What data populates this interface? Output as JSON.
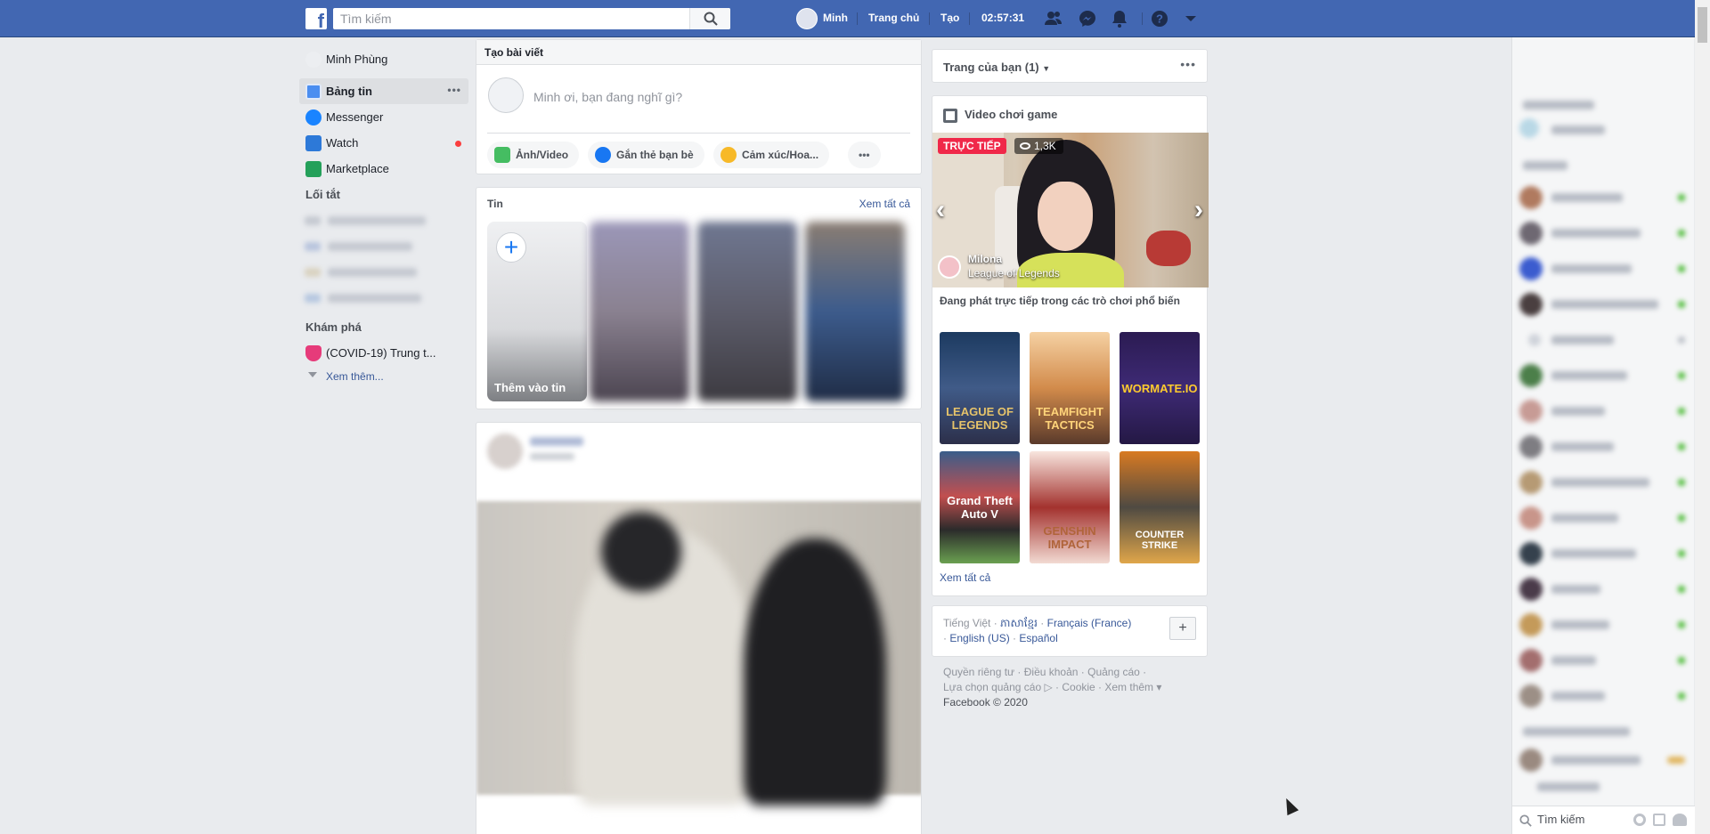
{
  "header": {
    "logo_letter": "f",
    "search_placeholder": "Tìm kiếm",
    "user_name": "Minh",
    "home": "Trang chủ",
    "create": "Tạo",
    "clock": "02:57:31"
  },
  "left_nav": {
    "profile": "Minh Phùng",
    "items": [
      {
        "label": "Bảng tin",
        "active": true
      },
      {
        "label": "Messenger"
      },
      {
        "label": "Watch"
      },
      {
        "label": "Marketplace"
      }
    ],
    "shortcuts_heading": "Lối tắt",
    "explore_heading": "Khám phá",
    "explore_item": "(COVID-19) Trung t...",
    "see_more": "Xem thêm..."
  },
  "composer": {
    "header": "Tạo bài viết",
    "prompt": "Minh ơi, bạn đang nghĩ gì?",
    "actions": [
      "Ảnh/Video",
      "Gắn thẻ bạn bè",
      "Cảm xúc/Hoa..."
    ],
    "more": "•••"
  },
  "stories": {
    "title": "Tin",
    "see_all": "Xem tất cả",
    "add_label": "Thêm vào tin",
    "plus": "+"
  },
  "right": {
    "pages_title": "Trang của bạn (1)",
    "pages_more": "•••",
    "games_title": "Video chơi game",
    "live_badge": "TRỰC TIẾP",
    "viewers": "1,3K",
    "streamer": "Milona",
    "stream_game": "League of Legends",
    "games_desc": "Đang phát trực tiếp trong các trò chơi phổ biến",
    "tiles": [
      "LEAGUE OF LEGENDS",
      "TEAMFIGHT TACTICS",
      "WORMATE.IO",
      "Grand Theft Auto V",
      "GENSHIN IMPACT",
      "COUNTER STRIKE"
    ],
    "games_see_all": "Xem tất cả"
  },
  "languages": {
    "current": "Tiếng Việt",
    "others": [
      "ភាសាខ្មែរ",
      "Français (France)",
      "English (US)",
      "Español"
    ],
    "add": "+"
  },
  "footer": {
    "line1": "Quyền riêng tư · Điều khoản · Quảng cáo ·",
    "line2": "Lựa chọn quảng cáo ▷ · Cookie · Xem thêm ▾",
    "copyright": "Facebook © 2020"
  },
  "chat": {
    "search_placeholder": "Tìm kiếm"
  }
}
